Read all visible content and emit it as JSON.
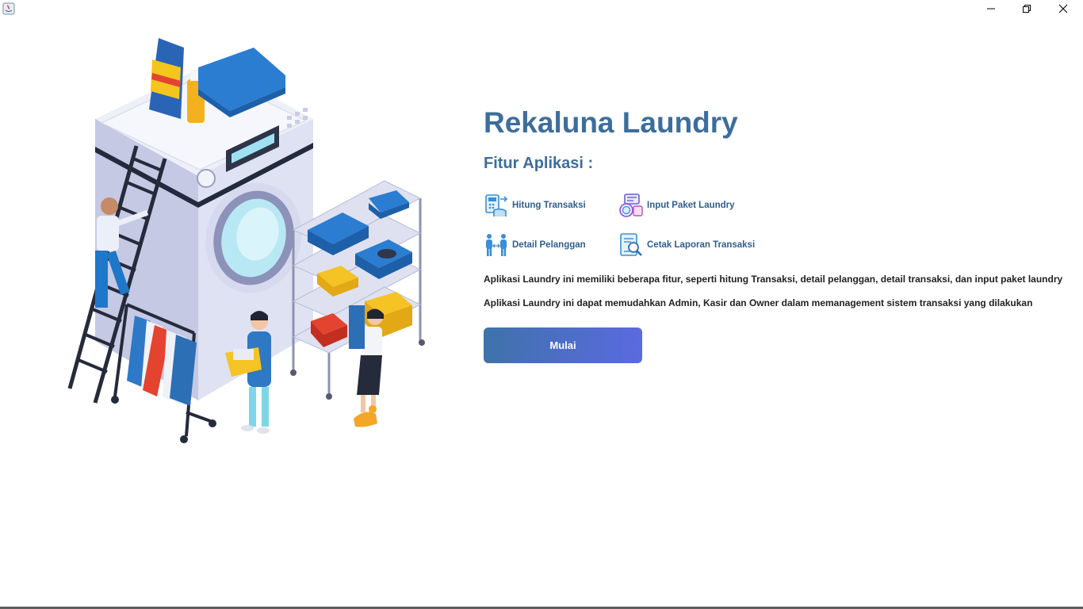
{
  "window": {
    "icons": {
      "app": "java-app-icon",
      "minimize": "minimize-icon",
      "restore": "restore-icon",
      "close": "close-icon"
    }
  },
  "main": {
    "title": "Rekaluna Laundry",
    "features_heading": "Fitur Aplikasi :",
    "features": [
      {
        "label": "Hitung Transaksi",
        "icon": "calculate-transaction-icon"
      },
      {
        "label": "Input Paket Laundry",
        "icon": "laundry-package-icon"
      },
      {
        "label": "Detail Pelanggan",
        "icon": "customer-icon"
      },
      {
        "label": "Cetak Laporan Transaksi",
        "icon": "report-icon"
      }
    ],
    "descriptions": [
      "Aplikasi Laundry ini memiliki beberapa fitur, seperti hitung Transaksi, detail pelanggan, detail transaksi, dan input paket laundry",
      "Aplikasi Laundry ini dapat memudahkan Admin, Kasir dan Owner dalam memanagement sistem transaksi yang dilakukan"
    ],
    "start_button": "Mulai"
  },
  "illustration": {
    "icon": "laundry-illustration"
  },
  "colors": {
    "title": "#3c6e9d",
    "button_start": "#3f72aa",
    "button_end": "#5a6ae0"
  }
}
